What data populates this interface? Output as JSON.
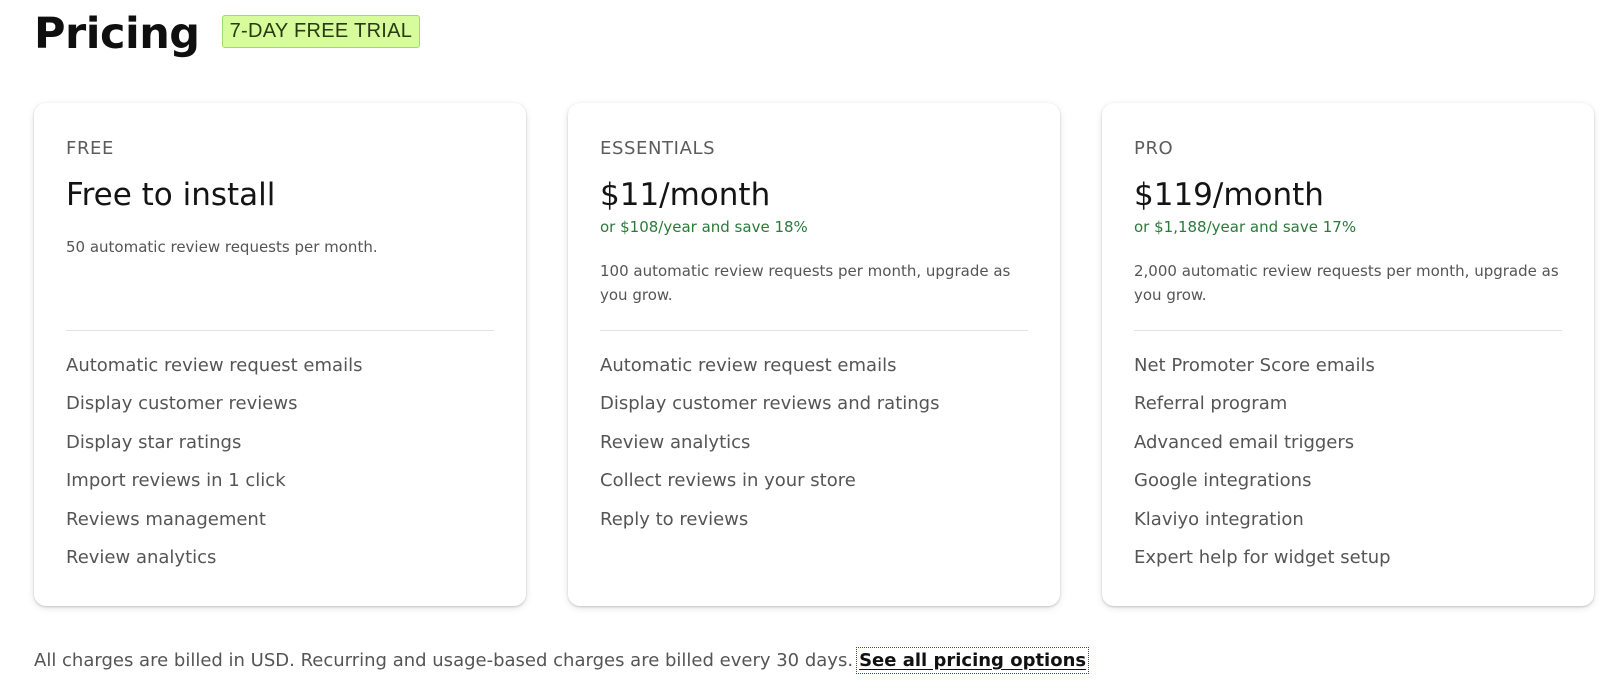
{
  "header": {
    "title": "Pricing",
    "trial_badge": "7-DAY FREE TRIAL"
  },
  "plans": [
    {
      "tier": "FREE",
      "price": "Free to install",
      "annual": "",
      "description": "50 automatic review requests per month.",
      "features": [
        "Automatic review request emails",
        "Display customer reviews",
        "Display star ratings",
        "Import reviews in 1 click",
        "Reviews management",
        "Review analytics"
      ]
    },
    {
      "tier": "ESSENTIALS",
      "price": "$11/month",
      "annual": "or $108/year and save 18%",
      "description": "100 automatic review requests per month, upgrade as you grow.",
      "features": [
        "Automatic review request emails",
        "Display customer reviews and ratings",
        "Review analytics",
        "Collect reviews in your store",
        "Reply to reviews"
      ]
    },
    {
      "tier": "PRO",
      "price": "$119/month",
      "annual": "or $1,188/year and save 17%",
      "description": "2,000 automatic review requests per month, upgrade as you grow.",
      "features": [
        "Net Promoter Score emails",
        "Referral program",
        "Advanced email triggers",
        "Google integrations",
        "Klaviyo integration",
        "Expert help for widget setup"
      ]
    }
  ],
  "footer": {
    "note": "All charges are billed in USD. Recurring and usage-based charges are billed every 30 days.",
    "link": "See all pricing options"
  },
  "colors": {
    "badge_bg": "#d6fc9b",
    "annual_green": "#2a7a3a",
    "link_focus_outline": "#d0121b"
  }
}
